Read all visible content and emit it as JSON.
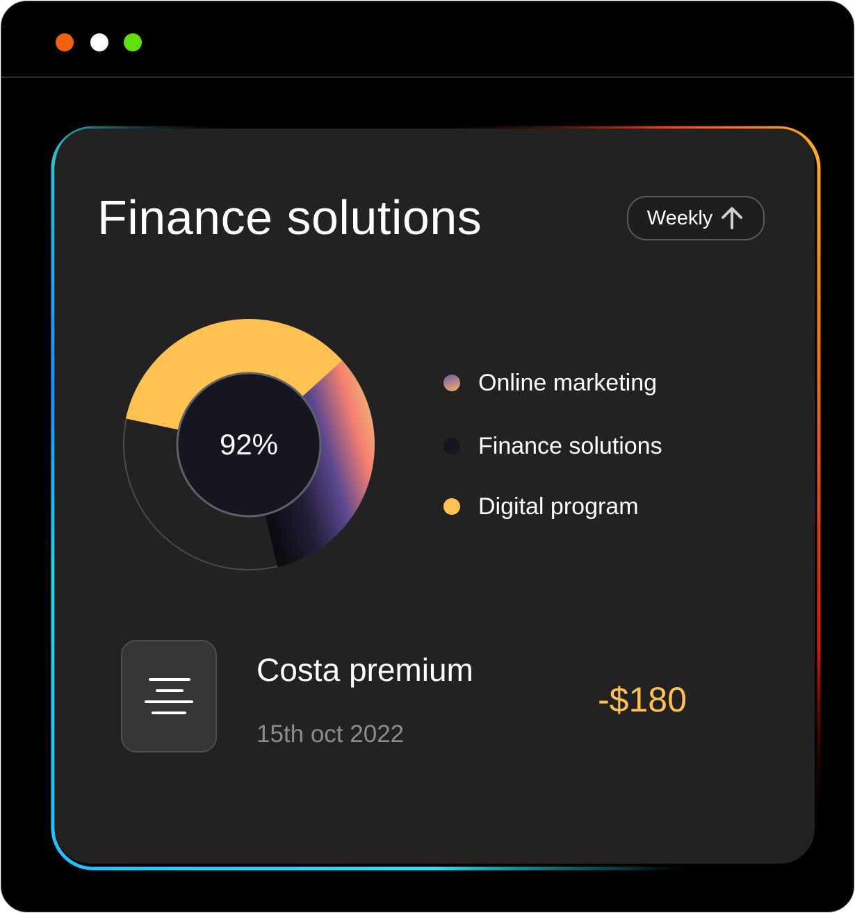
{
  "window": {
    "controls": [
      {
        "name": "close",
        "color": "#f0620b"
      },
      {
        "name": "minimize",
        "color": "#ffffff"
      },
      {
        "name": "maximize",
        "color": "#62e004"
      }
    ]
  },
  "card": {
    "title": "Finance solutions",
    "period_button": {
      "label": "Weekly",
      "icon": "arrow-up-icon"
    }
  },
  "chart_data": {
    "type": "pie",
    "center_label": "92%",
    "title": "",
    "series": [
      {
        "name": "Digital program",
        "value": 35,
        "color": "#ffc14f"
      },
      {
        "name": "Online marketing",
        "value": 33,
        "color": "gradient:#0b0b12-#5c4891-#f58070-#ebc077"
      },
      {
        "name": "Finance solutions",
        "value": 32,
        "color": "#3a3a3a"
      }
    ],
    "legend_placement": "right"
  },
  "legend": {
    "items": [
      {
        "label": "Online marketing",
        "color": "gradient:#6a5aa8-#ffb26a"
      },
      {
        "label": "Finance solutions",
        "color": "#151720"
      },
      {
        "label": "Digital program",
        "color": "#ffc14f"
      }
    ]
  },
  "transaction": {
    "icon": "menu-lines-icon",
    "name": "Costa premium",
    "date": "15th oct 2022",
    "amount": "-$180"
  },
  "colors": {
    "background": "#000000",
    "card": "#222222",
    "accent": "#ffc14f",
    "border_gradient": [
      "#24b7c9",
      "#0f8bff",
      "#22e6f7",
      "#ff4a12",
      "#ffc12a"
    ]
  }
}
